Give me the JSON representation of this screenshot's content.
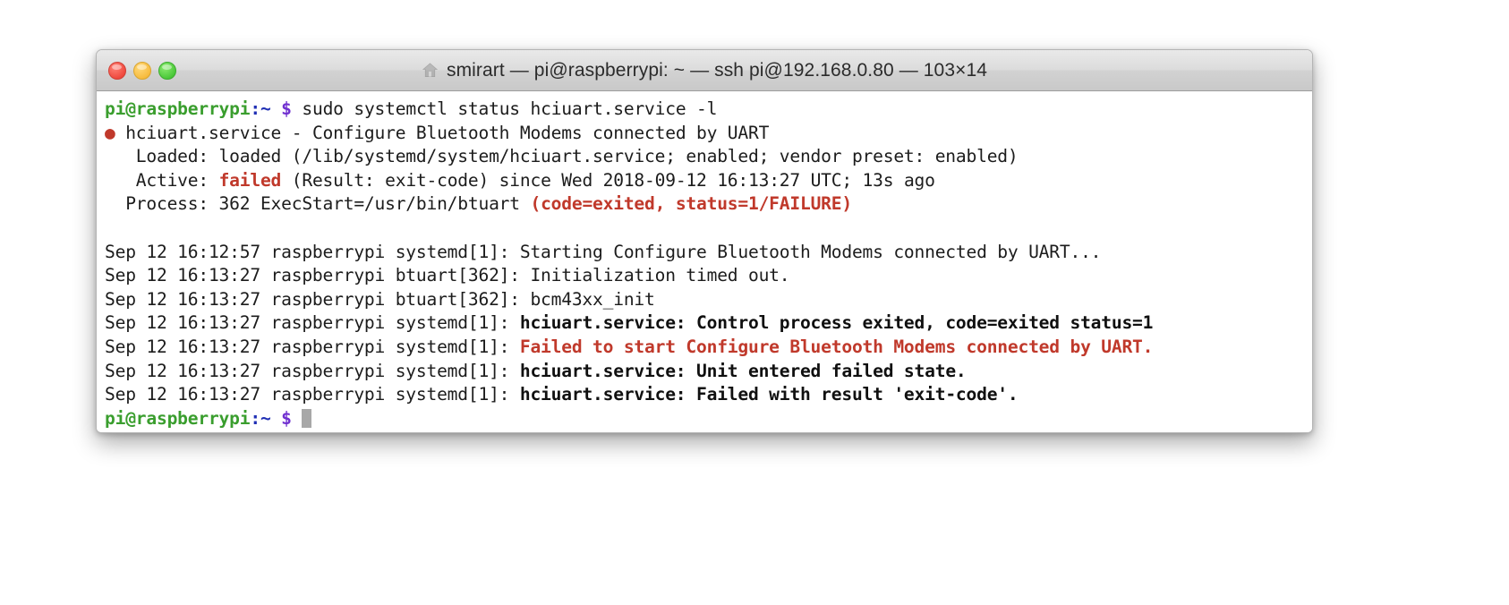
{
  "window": {
    "title": "smirart — pi@raspberrypi: ~ — ssh pi@192.168.0.80 — 103×14",
    "icon": "home-icon",
    "columns": 103,
    "rows": 14,
    "buttons": {
      "close": "close-button",
      "minimize": "minimize-button",
      "maximize": "maximize-button"
    }
  },
  "colors": {
    "prompt_user_host": "#3a9e2e",
    "prompt_path": "#1f2fb4",
    "prompt_symbol": "#7030d0",
    "error_red": "#c0392b",
    "text": "#1c1c1c",
    "background": "#ffffff",
    "titlebar": "#dcdcdc"
  },
  "terminal": {
    "command": "sudo systemctl status hciuart.service -l",
    "prompt": {
      "user_host": "pi@raspberrypi",
      "path": ":~",
      "symbol": "$"
    },
    "lines": {
      "l1_prompt_user": "pi@raspberrypi",
      "l1_prompt_path": ":~",
      "l1_prompt_symbol": "$",
      "l1_command": " sudo systemctl status hciuart.service -l",
      "l2_dot": "●",
      "l2_text": " hciuart.service - Configure Bluetooth Modems connected by UART",
      "l3": "   Loaded: loaded (/lib/systemd/system/hciuart.service; enabled; vendor preset: enabled)",
      "l4_a": "   Active: ",
      "l4_status": "failed",
      "l4_b": " (Result: exit-code) since Wed 2018-09-12 16:13:27 UTC; 13s ago",
      "l5_a": "  Process: 362 ExecStart=/usr/bin/btuart ",
      "l5_b": "(code=exited, status=1/FAILURE)",
      "l6": "",
      "l7": "Sep 12 16:12:57 raspberrypi systemd[1]: Starting Configure Bluetooth Modems connected by UART...",
      "l8": "Sep 12 16:13:27 raspberrypi btuart[362]: Initialization timed out.",
      "l9": "Sep 12 16:13:27 raspberrypi btuart[362]: bcm43xx_init",
      "l10_a": "Sep 12 16:13:27 raspberrypi systemd[1]: ",
      "l10_b": "hciuart.service: Control process exited, code=exited status=1",
      "l11_a": "Sep 12 16:13:27 raspberrypi systemd[1]: ",
      "l11_b": "Failed to start Configure Bluetooth Modems connected by UART.",
      "l12_a": "Sep 12 16:13:27 raspberrypi systemd[1]: ",
      "l12_b": "hciuart.service: Unit entered failed state.",
      "l13_a": "Sep 12 16:13:27 raspberrypi systemd[1]: ",
      "l13_b": "hciuart.service: Failed with result 'exit-code'.",
      "l14_prompt_user": "pi@raspberrypi",
      "l14_prompt_path": ":~",
      "l14_prompt_symbol": "$"
    }
  }
}
